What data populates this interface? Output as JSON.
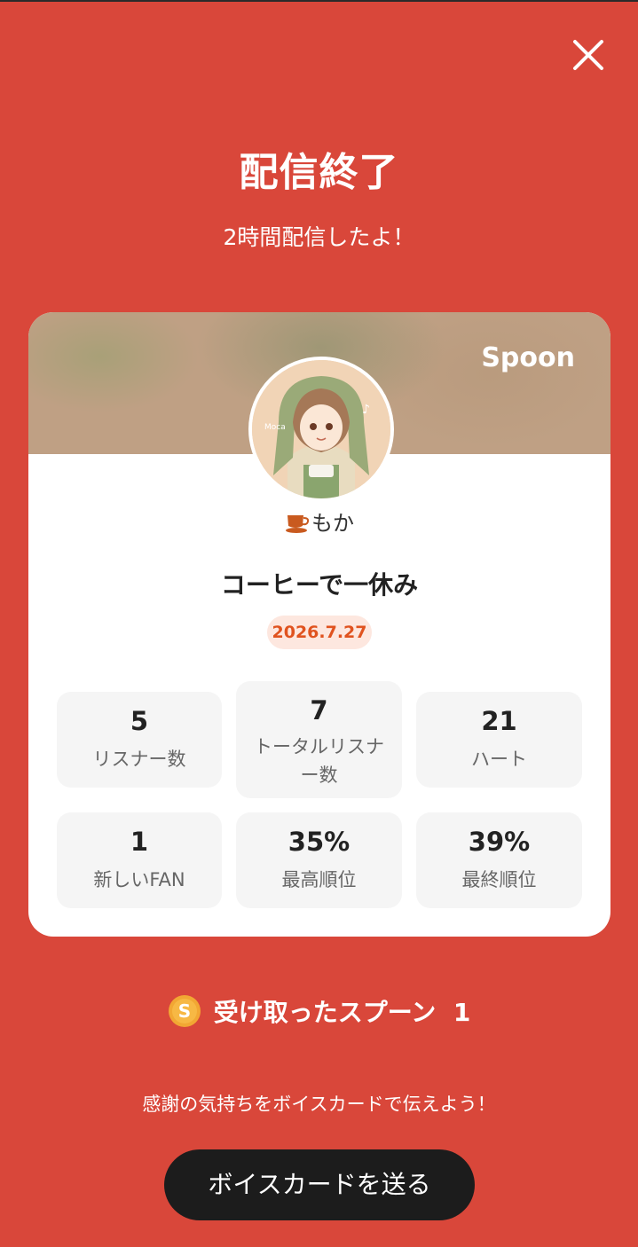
{
  "header": {
    "title": "配信終了",
    "subtitle": "2時間配信したよ！",
    "close_icon": "close-icon"
  },
  "card": {
    "brand": "Spoon",
    "user": {
      "name": "もか",
      "badge_icon": "coffee-cup-icon"
    },
    "stream_title": "コーヒーで一休み",
    "date": "2026.7.27",
    "stats": [
      {
        "value": "5",
        "label": "リスナー数"
      },
      {
        "value": "7",
        "label": "トータルリスナー数"
      },
      {
        "value": "21",
        "label": "ハート"
      },
      {
        "value": "1",
        "label": "新しいFAN"
      },
      {
        "value": "35%",
        "label": "最高順位"
      },
      {
        "value": "39%",
        "label": "最終順位"
      }
    ]
  },
  "spoons": {
    "icon": "spoon-coin-icon",
    "label": "受け取ったスプーン",
    "count": "1"
  },
  "thanks_text": "感謝の気持ちをボイスカードで伝えよう！",
  "voice_card_button": "ボイスカードを送る",
  "colors": {
    "background": "#d9473a",
    "accent": "#e0531f",
    "button": "#1c1c1c"
  }
}
